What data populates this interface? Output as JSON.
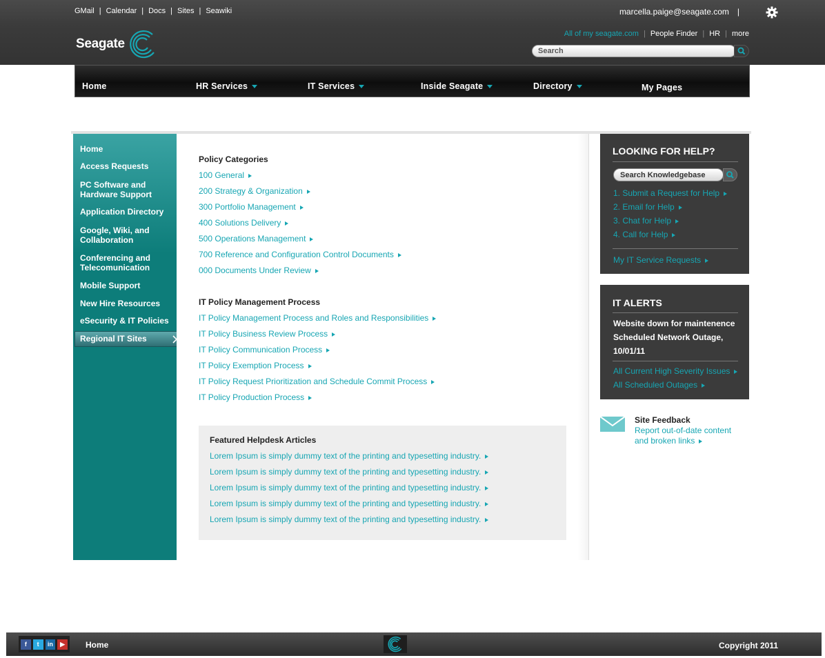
{
  "header": {
    "top_links": [
      "GMail",
      "Calendar",
      "Docs",
      "Sites",
      "Seawiki"
    ],
    "user_email": "marcella.paige@seagate.com",
    "user_pipe": "|",
    "logo_text": "Seagate",
    "quick_links": [
      "All of my seagate.com",
      "People Finder",
      "HR",
      "more"
    ],
    "quick_sep": "|",
    "search_placeholder": "Search"
  },
  "nav": {
    "items": [
      "Home",
      "HR Services",
      "IT Services",
      "Inside Seagate",
      "Directory",
      "My Pages"
    ]
  },
  "sidebar": {
    "items": [
      "Home",
      "Access Requests",
      "PC Software and Hardware Support",
      "Application Directory",
      "Google, Wiki, and Collaboration",
      "Conferencing and Telecomunication",
      "Mobile Support",
      "New Hire Resources",
      "eSecurity & IT Policies",
      "Regional IT Sites"
    ]
  },
  "main": {
    "policy_heading": "Policy Categories",
    "policy_links": [
      "100 General",
      "200 Strategy & Organization",
      "300 Portfolio Management",
      "400 Solutions Delivery",
      "500 Operations Management",
      "700 Reference and Configuration Control Documents",
      "000 Documents Under Review"
    ],
    "process_heading": "IT Policy Management Process",
    "process_links": [
      "IT Policy Management Process and Roles and Responsibilities",
      "IT Policy Business Review Process",
      "IT Policy Communication Process",
      "IT Policy Exemption Process",
      "IT Policy Request Prioritization and Schedule Commit Process",
      "IT Policy Production Process"
    ],
    "featured_heading": "Featured Helpdesk Articles",
    "featured_links": [
      "Lorem Ipsum is simply dummy text of the printing and typesetting industry.",
      "Lorem Ipsum is simply dummy text of the printing and typesetting industry.",
      "Lorem Ipsum is simply dummy text of the printing and typesetting industry.",
      "Lorem Ipsum is simply dummy text of the printing and typesetting industry.",
      "Lorem Ipsum is simply dummy text of the printing and typesetting industry."
    ]
  },
  "help": {
    "title": "LOOKING FOR HELP?",
    "search_placeholder": "Search Knowledgebase",
    "links": [
      "1. Submit a Request for Help",
      "2. Email for Help",
      "3. Chat for Help",
      "4. Call for Help"
    ],
    "service_requests": "My IT Service Requests"
  },
  "alerts": {
    "title": "IT ALERTS",
    "message_1": "Website down for maintenence",
    "message_2": "Scheduled Network Outage, 10/01/11",
    "links": [
      "All Current High Severity Issues",
      "All Scheduled Outages"
    ]
  },
  "feedback": {
    "title": "Site Feedback",
    "text": "Report out-of-date content and broken links"
  },
  "footer": {
    "home": "Home",
    "copyright": "Copyright 2011"
  },
  "colors": {
    "accent": "#17a6b3",
    "sidebar": "#0d7d7a",
    "header": "#3b3b3b"
  }
}
